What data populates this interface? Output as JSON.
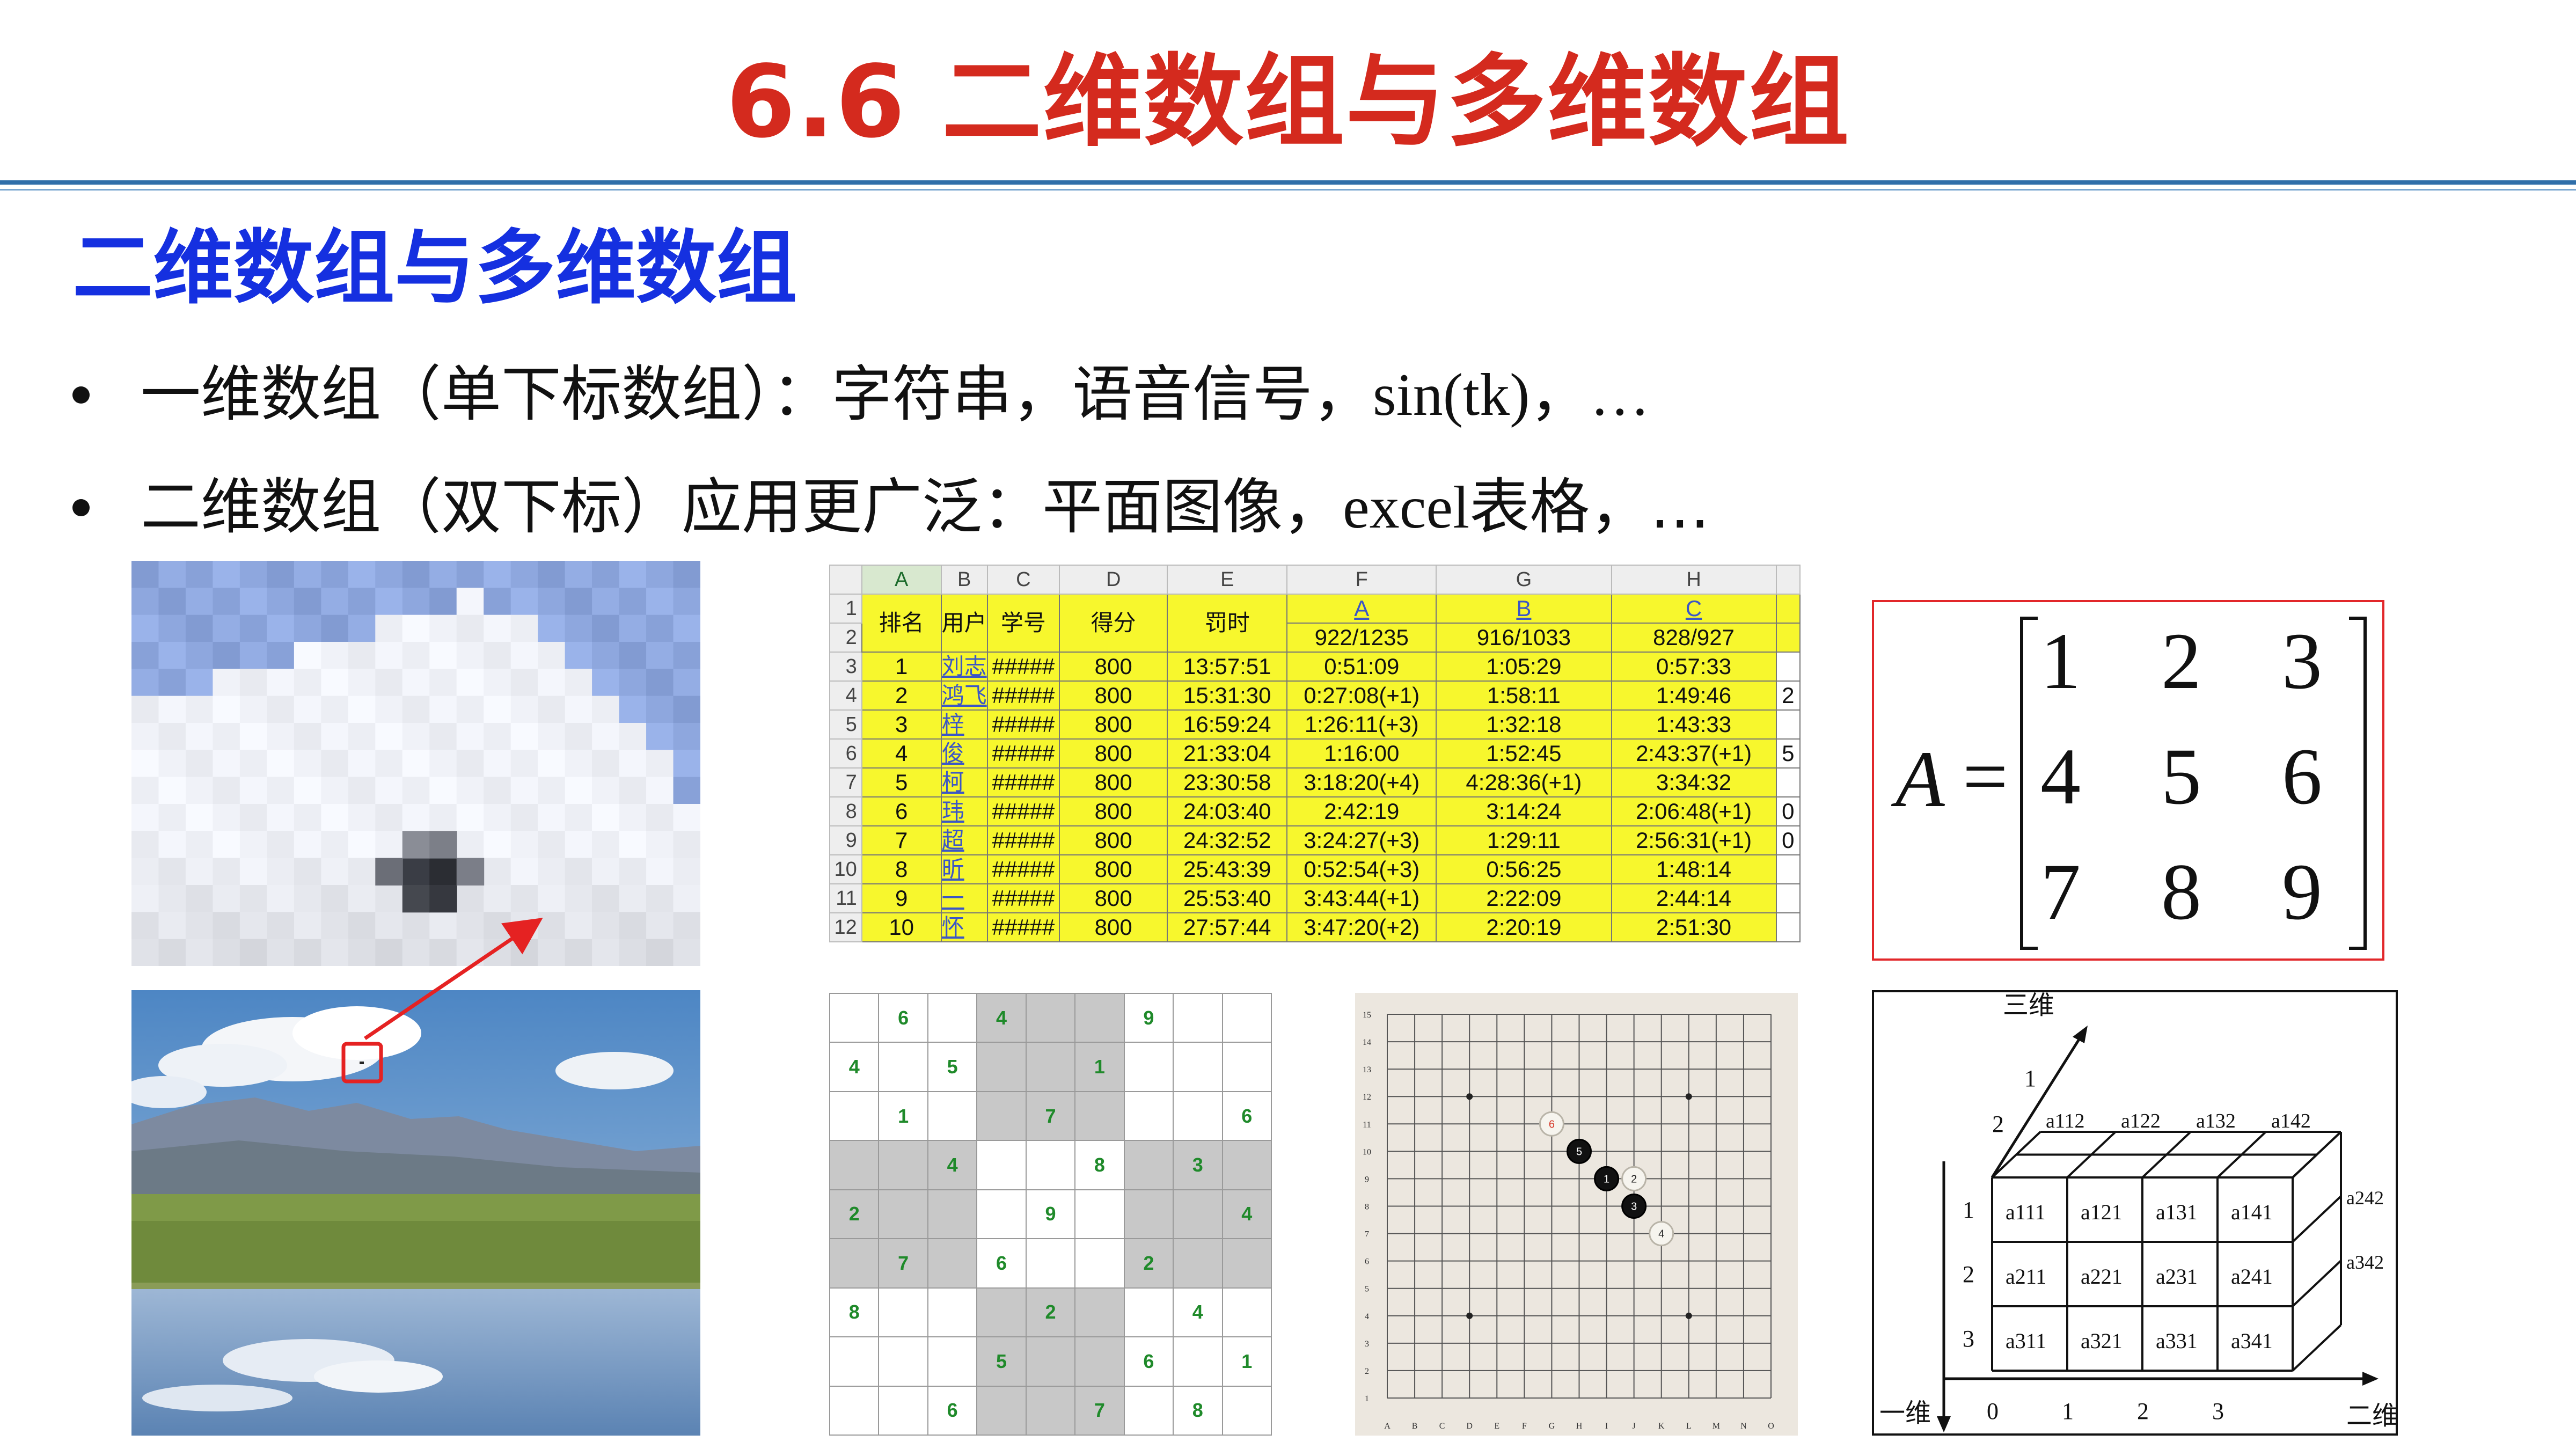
{
  "title": "6.6 二维数组与多维数组",
  "section_heading": "二维数组与多维数组",
  "bullets": [
    {
      "prefix": "一维数组（单下标数组）：字符串，语音信号，",
      "latin": "sin(tk)，…",
      "suffix": ""
    },
    {
      "prefix": "二维数组（双下标）应用更广泛：平面图像，",
      "latin": "excel",
      "suffix": "表格，…"
    }
  ],
  "spreadsheet": {
    "col_letters": [
      "A",
      "B",
      "C",
      "D",
      "E",
      "F",
      "G",
      "H"
    ],
    "row_numbers": [
      "1",
      "2",
      "3",
      "4",
      "5",
      "6",
      "7",
      "8",
      "9",
      "10",
      "11",
      "12"
    ],
    "headers": [
      "排名",
      "用户",
      "学号",
      "得分",
      "罚时"
    ],
    "problem_links": [
      "A",
      "B",
      "C"
    ],
    "problem_ratios": [
      "922/1235",
      "916/1033",
      "828/927"
    ],
    "rows": [
      [
        "1",
        "刘志",
        "#####",
        "800",
        "13:57:51",
        "0:51:09",
        "1:05:29",
        "0:57:33",
        ""
      ],
      [
        "2",
        "鸿飞",
        "#####",
        "800",
        "15:31:30",
        "0:27:08(+1)",
        "1:58:11",
        "1:49:46",
        "2"
      ],
      [
        "3",
        "梓",
        "#####",
        "800",
        "16:59:24",
        "1:26:11(+3)",
        "1:32:18",
        "1:43:33",
        ""
      ],
      [
        "4",
        "俊",
        "#####",
        "800",
        "21:33:04",
        "1:16:00",
        "1:52:45",
        "2:43:37(+1)",
        "5"
      ],
      [
        "5",
        "柯",
        "#####",
        "800",
        "23:30:58",
        "3:18:20(+4)",
        "4:28:36(+1)",
        "3:34:32",
        ""
      ],
      [
        "6",
        "玮",
        "#####",
        "800",
        "24:03:40",
        "2:42:19",
        "3:14:24",
        "2:06:48(+1)",
        "0"
      ],
      [
        "7",
        "超",
        "#####",
        "800",
        "24:32:52",
        "3:24:27(+3)",
        "1:29:11",
        "2:56:31(+1)",
        "0"
      ],
      [
        "8",
        "昕",
        "#####",
        "800",
        "25:43:39",
        "0:52:54(+3)",
        "0:56:25",
        "1:48:14",
        ""
      ],
      [
        "9",
        "一",
        "#####",
        "800",
        "25:53:40",
        "3:43:44(+1)",
        "2:22:09",
        "2:44:14",
        ""
      ],
      [
        "10",
        "怀",
        "#####",
        "800",
        "27:57:44",
        "3:47:20(+2)",
        "2:20:19",
        "2:51:30",
        ""
      ]
    ]
  },
  "sudoku": [
    [
      "",
      "6",
      "",
      "4",
      "",
      "",
      "9",
      "",
      ""
    ],
    [
      "4",
      "",
      "5",
      "",
      "",
      "1",
      "",
      "",
      ""
    ],
    [
      "",
      "1",
      "",
      "",
      "7",
      "",
      "",
      "",
      "6"
    ],
    [
      "",
      "",
      "4",
      "",
      "",
      "8",
      "",
      "3",
      ""
    ],
    [
      "2",
      "",
      "",
      "",
      "9",
      "",
      "",
      "",
      "4"
    ],
    [
      "",
      "7",
      "",
      "6",
      "",
      "",
      "2",
      "",
      ""
    ],
    [
      "8",
      "",
      "",
      "",
      "2",
      "",
      "",
      "4",
      ""
    ],
    [
      "",
      "",
      "",
      "5",
      "",
      "",
      "6",
      "",
      "1"
    ],
    [
      "",
      "",
      "6",
      "",
      "",
      "7",
      "",
      "8",
      ""
    ]
  ],
  "go_board": {
    "row_labels": [
      "15",
      "14",
      "13",
      "12",
      "11",
      "10",
      "9",
      "8",
      "7",
      "6",
      "5",
      "4",
      "3",
      "2",
      "1"
    ],
    "col_labels": [
      "A",
      "B",
      "C",
      "D",
      "E",
      "F",
      "G",
      "H",
      "I",
      "J",
      "K",
      "L",
      "M",
      "N",
      "O"
    ],
    "stones": [
      {
        "col": 6,
        "row": 11,
        "color": "white",
        "label": "6"
      },
      {
        "col": 7,
        "row": 10,
        "color": "black",
        "label": "5"
      },
      {
        "col": 8,
        "row": 9,
        "color": "black",
        "label": "1"
      },
      {
        "col": 9,
        "row": 9,
        "color": "white",
        "label": "2"
      },
      {
        "col": 9,
        "row": 8,
        "color": "black",
        "label": "3"
      },
      {
        "col": 10,
        "row": 7,
        "color": "white",
        "label": "4"
      }
    ]
  },
  "matrix": {
    "label": "A",
    "equals": "=",
    "rows": [
      [
        "1",
        "2",
        "3"
      ],
      [
        "4",
        "5",
        "6"
      ],
      [
        "7",
        "8",
        "9"
      ]
    ]
  },
  "array3d": {
    "axis_labels": {
      "dim1": "一维",
      "dim2": "二维",
      "dim3": "三维"
    },
    "front_cells": [
      [
        "a111",
        "a121",
        "a131",
        "a141"
      ],
      [
        "a211",
        "a221",
        "a231",
        "a241"
      ],
      [
        "a311",
        "a321",
        "a331",
        "a341"
      ]
    ],
    "top_cells": [
      "a112",
      "a122",
      "a132",
      "a142"
    ],
    "side_cells": [
      "a242",
      "a342"
    ],
    "row_ticks": [
      "1",
      "2",
      "3"
    ],
    "col_ticks": [
      "0",
      "1",
      "2",
      "3"
    ],
    "depth_ticks": [
      "1",
      "2"
    ]
  },
  "colors": {
    "title": "#d42a1e",
    "heading": "#1530e0",
    "rule": "#2f6ea9",
    "highlight_box": "#e2272a",
    "sheet_fill": "#f7f72d",
    "sudoku_digit": "#1f8a2a"
  }
}
